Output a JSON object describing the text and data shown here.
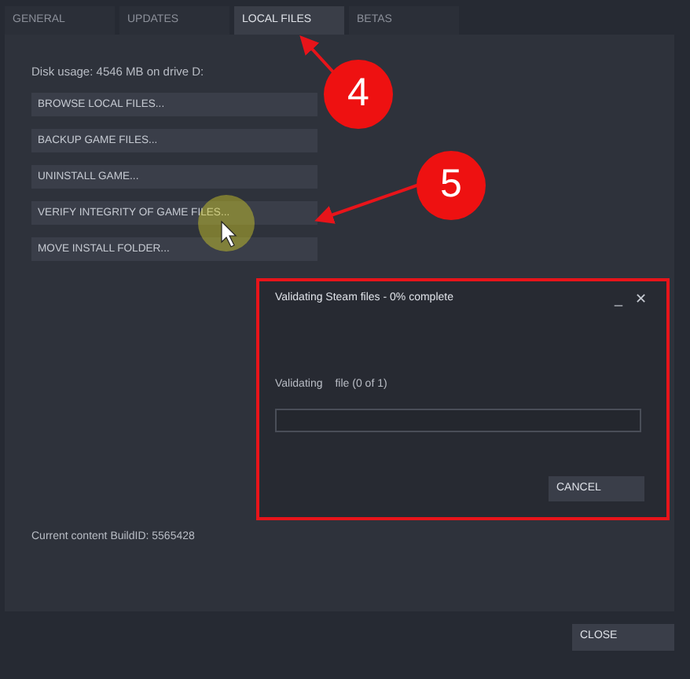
{
  "tabs": [
    {
      "label": "GENERAL",
      "selected": false
    },
    {
      "label": "UPDATES",
      "selected": false
    },
    {
      "label": "LOCAL FILES",
      "selected": true
    },
    {
      "label": "BETAS",
      "selected": false
    }
  ],
  "disk_usage": "Disk usage: 4546 MB on drive D:",
  "actions": [
    "BROWSE LOCAL FILES...",
    "BACKUP GAME FILES...",
    "UNINSTALL GAME...",
    "VERIFY INTEGRITY OF GAME FILES...",
    "MOVE INSTALL FOLDER..."
  ],
  "build_id": "Current content BuildID: 5565428",
  "close_button": "CLOSE",
  "dialog": {
    "title": "Validating Steam files - 0% complete",
    "minimize": "_",
    "close": "✕",
    "status_label": "Validating",
    "status_detail": "file (0 of 1)",
    "progress": {
      "level": 0
    },
    "cancel_button": "CANCEL"
  },
  "annotations": [
    {
      "number": "4"
    },
    {
      "number": "5"
    }
  ]
}
